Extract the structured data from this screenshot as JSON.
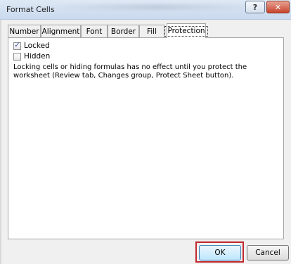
{
  "window": {
    "title": "Format Cells"
  },
  "titlebar": {
    "help_glyph": "?",
    "close_glyph": "✕"
  },
  "tabs": [
    {
      "label": "Number"
    },
    {
      "label": "Alignment"
    },
    {
      "label": "Font"
    },
    {
      "label": "Border"
    },
    {
      "label": "Fill"
    },
    {
      "label": "Protection",
      "active": true
    }
  ],
  "protection": {
    "locked": {
      "label": "Locked",
      "checked": true
    },
    "hidden": {
      "label": "Hidden",
      "checked": false
    },
    "note": "Locking cells or hiding formulas has no effect until you protect the worksheet (Review tab, Changes group, Protect Sheet button)."
  },
  "buttons": {
    "ok": "OK",
    "cancel": "Cancel"
  },
  "colors": {
    "highlight": "#c0282e",
    "check": "#2a4d9c"
  }
}
